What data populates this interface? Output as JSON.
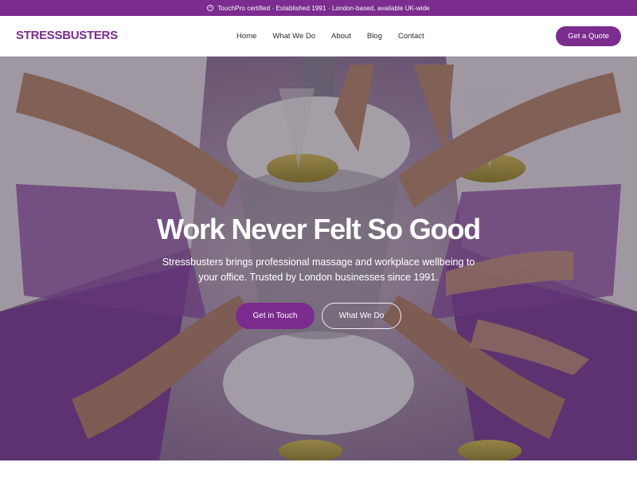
{
  "topbar": {
    "text": "TouchPro certified · Established 1991 · London-based, available UK-wide",
    "icon": "check-circle-icon"
  },
  "header": {
    "logo": "STRESSBUSTERS",
    "nav": [
      "Home",
      "What We Do",
      "About",
      "Blog",
      "Contact"
    ],
    "cta": "Get a Quote"
  },
  "hero": {
    "title": "Work Never Felt So Good",
    "subtitle": "Stressbusters brings professional massage and workplace wellbeing to your office. Trusted by London businesses since 1991.",
    "primary_button": "Get in Touch",
    "secondary_button": "What We Do",
    "image": "massage-oil-hands-photo"
  },
  "colors": {
    "brand": "#7b2c8e",
    "text_dark": "#2a2a2a",
    "white": "#ffffff"
  }
}
